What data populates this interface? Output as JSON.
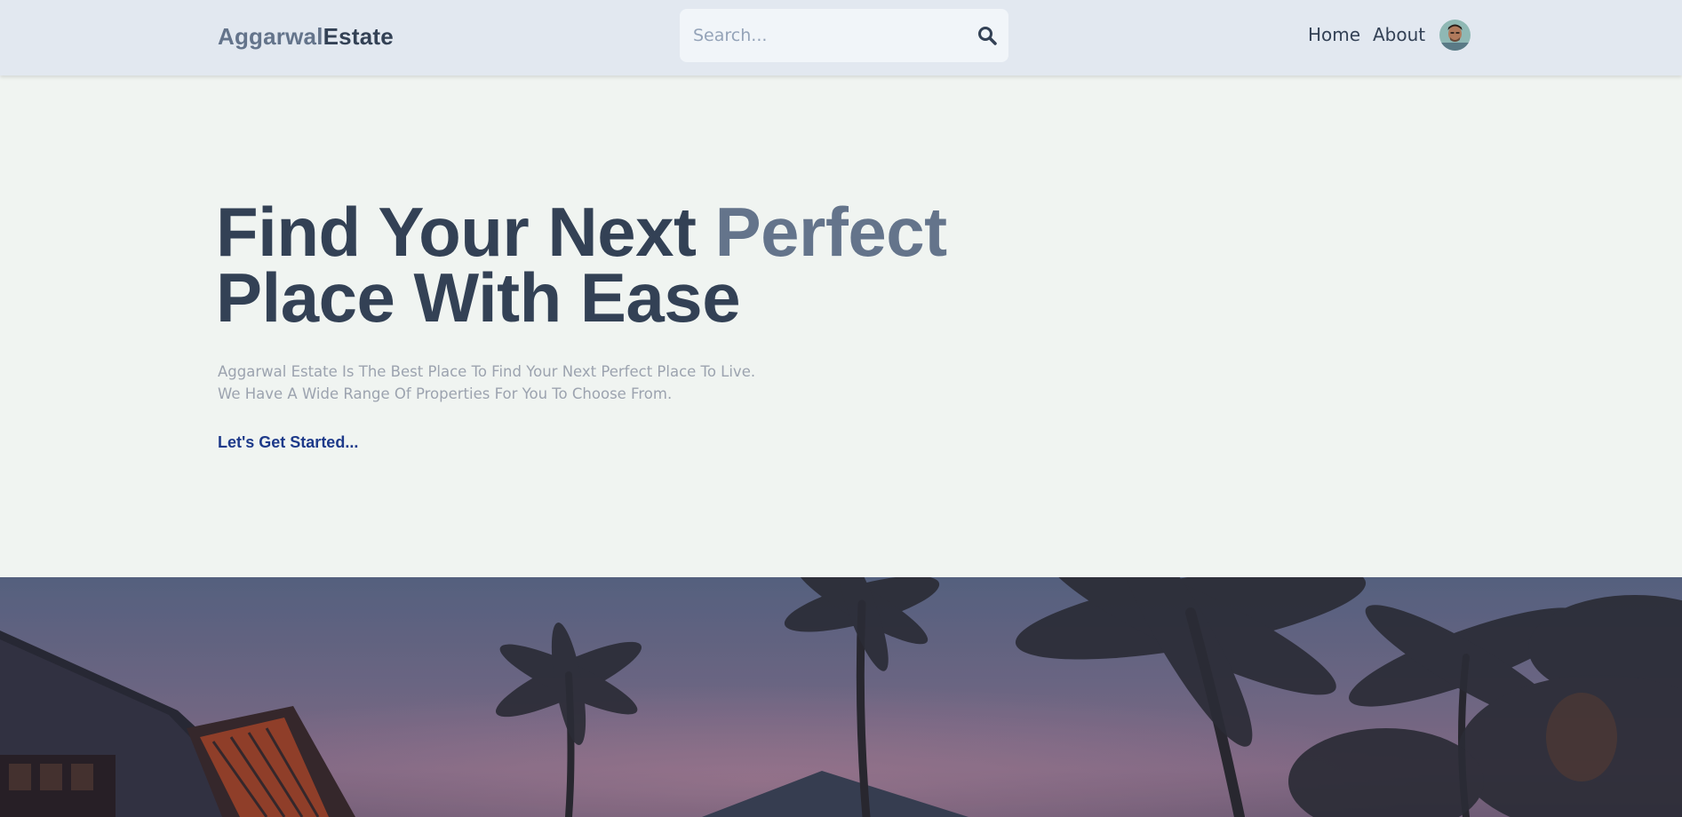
{
  "header": {
    "logo_part1": "Aggarwal",
    "logo_part2": "Estate",
    "search_placeholder": "Search...",
    "search_icon": "search-icon",
    "nav": {
      "home": "Home",
      "about": "About"
    },
    "avatar": "user-avatar"
  },
  "hero": {
    "title_part1": "Find Your Next ",
    "title_accent": "Perfect",
    "title_part2": "Place With Ease",
    "subtitle_line1": "Aggarwal Estate Is The Best Place To Find Your Next Perfect Place To Live.",
    "subtitle_line2": "We Have A Wide Range Of Properties For You To Choose From.",
    "cta": "Let's Get Started..."
  },
  "colors": {
    "header_bg": "#e2e8f0",
    "page_bg": "#f0f4f1",
    "heading": "#334155",
    "accent": "#64748b",
    "cta": "#1e3a8a"
  }
}
